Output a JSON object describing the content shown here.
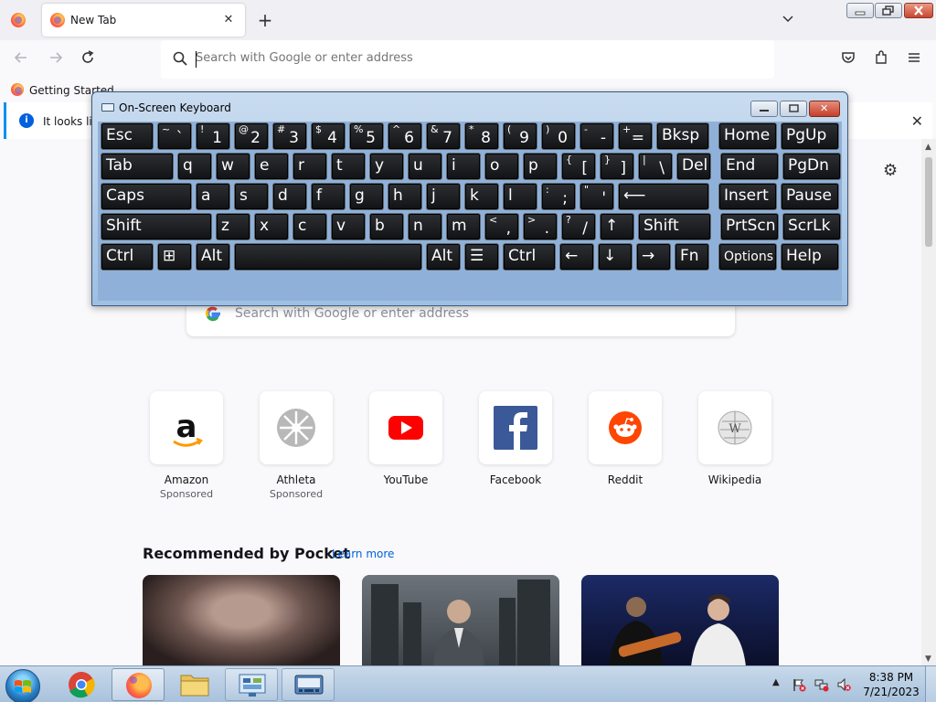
{
  "browser": {
    "tab_title": "New Tab",
    "url_placeholder": "Search with Google or enter address",
    "bookmark_label": "Getting Started",
    "notification_text": "It looks like"
  },
  "page": {
    "search_placeholder": "Search with Google or enter address",
    "shortcuts": [
      {
        "label": "Amazon",
        "sub": "Sponsored",
        "icon": "amazon-icon"
      },
      {
        "label": "Athleta",
        "sub": "Sponsored",
        "icon": "athleta-icon"
      },
      {
        "label": "YouTube",
        "sub": "",
        "icon": "youtube-icon"
      },
      {
        "label": "Facebook",
        "sub": "",
        "icon": "facebook-icon"
      },
      {
        "label": "Reddit",
        "sub": "",
        "icon": "reddit-icon"
      },
      {
        "label": "Wikipedia",
        "sub": "",
        "icon": "wikipedia-icon"
      }
    ],
    "pocket_title": "Recommended by Pocket",
    "pocket_link": "Learn more"
  },
  "osk": {
    "title": "On-Screen Keyboard",
    "rows": [
      [
        {
          "m": "Esc",
          "w": 60
        },
        {
          "s": "~",
          "b": "`",
          "w": 40
        },
        {
          "s": "!",
          "b": "1",
          "w": 40
        },
        {
          "s": "@",
          "b": "2",
          "w": 40
        },
        {
          "s": "#",
          "b": "3",
          "w": 40
        },
        {
          "s": "$",
          "b": "4",
          "w": 40
        },
        {
          "s": "%",
          "b": "5",
          "w": 40
        },
        {
          "s": "^",
          "b": "6",
          "w": 40
        },
        {
          "s": "&",
          "b": "7",
          "w": 40
        },
        {
          "s": "*",
          "b": "8",
          "w": 40
        },
        {
          "s": "(",
          "b": "9",
          "w": 40
        },
        {
          "s": ")",
          "b": "0",
          "w": 40
        },
        {
          "s": "-",
          "b": "-",
          "w": 40
        },
        {
          "s": "+",
          "b": "=",
          "w": 40
        },
        {
          "m": "Bksp",
          "w": 60
        },
        {
          "gap": 6
        },
        {
          "m": "Home",
          "w": 66
        },
        {
          "m": "PgUp",
          "w": 66
        }
      ],
      [
        {
          "m": "Tab",
          "w": 82
        },
        {
          "m": "q",
          "w": 40
        },
        {
          "m": "w",
          "w": 40
        },
        {
          "m": "e",
          "w": 40
        },
        {
          "m": "r",
          "w": 40
        },
        {
          "m": "t",
          "w": 40
        },
        {
          "m": "y",
          "w": 40
        },
        {
          "m": "u",
          "w": 40
        },
        {
          "m": "i",
          "w": 40
        },
        {
          "m": "o",
          "w": 40
        },
        {
          "m": "p",
          "w": 40
        },
        {
          "s": "{",
          "b": "[",
          "w": 40
        },
        {
          "s": "}",
          "b": "]",
          "w": 40
        },
        {
          "s": "|",
          "b": "\\",
          "w": 40
        },
        {
          "m": "Del",
          "w": 40
        },
        {
          "gap": 6
        },
        {
          "m": "End",
          "w": 66
        },
        {
          "m": "PgDn",
          "w": 66
        }
      ],
      [
        {
          "m": "Caps",
          "w": 102
        },
        {
          "m": "a",
          "w": 40
        },
        {
          "m": "s",
          "w": 40
        },
        {
          "m": "d",
          "w": 40
        },
        {
          "m": "f",
          "w": 40
        },
        {
          "m": "g",
          "w": 40
        },
        {
          "m": "h",
          "w": 40
        },
        {
          "m": "j",
          "w": 40
        },
        {
          "m": "k",
          "w": 40
        },
        {
          "m": "l",
          "w": 40
        },
        {
          "s": ":",
          "b": ";",
          "w": 40
        },
        {
          "s": "\"",
          "b": "'",
          "w": 40
        },
        {
          "m": "⟵",
          "w": 102
        },
        {
          "gap": 6
        },
        {
          "m": "Insert",
          "w": 66
        },
        {
          "m": "Pause",
          "w": 66
        }
      ],
      [
        {
          "m": "Shift",
          "w": 124
        },
        {
          "m": "z",
          "w": 40
        },
        {
          "m": "x",
          "w": 40
        },
        {
          "m": "c",
          "w": 40
        },
        {
          "m": "v",
          "w": 40
        },
        {
          "m": "b",
          "w": 40
        },
        {
          "m": "n",
          "w": 40
        },
        {
          "m": "m",
          "w": 40
        },
        {
          "s": "<",
          "b": ",",
          "w": 40
        },
        {
          "s": ">",
          "b": ".",
          "w": 40
        },
        {
          "s": "?",
          "b": "/",
          "w": 40
        },
        {
          "m": "↑",
          "w": 40
        },
        {
          "m": "Shift",
          "w": 82
        },
        {
          "gap": 6
        },
        {
          "m": "PrtScn",
          "w": 66
        },
        {
          "m": "ScrLk",
          "w": 66
        }
      ],
      [
        {
          "m": "Ctrl",
          "w": 60
        },
        {
          "m": "⊞",
          "w": 40
        },
        {
          "m": "Alt",
          "w": 40
        },
        {
          "m": "",
          "w": 208
        },
        {
          "m": "Alt",
          "w": 40
        },
        {
          "m": "☰",
          "w": 40
        },
        {
          "m": "Ctrl",
          "w": 60
        },
        {
          "m": "←",
          "w": 40
        },
        {
          "m": "↓",
          "w": 40
        },
        {
          "m": "→",
          "w": 40
        },
        {
          "m": "Fn",
          "w": 40
        },
        {
          "gap": 6
        },
        {
          "m": "Options",
          "w": 66,
          "small": true
        },
        {
          "m": "Help",
          "w": 66
        }
      ]
    ]
  },
  "taskbar": {
    "time": "8:38 PM",
    "date": "7/21/2023"
  },
  "colors": {
    "accent": "#0060df",
    "osk_frame": "#9fbfe2",
    "key": "#1a1c1f"
  }
}
